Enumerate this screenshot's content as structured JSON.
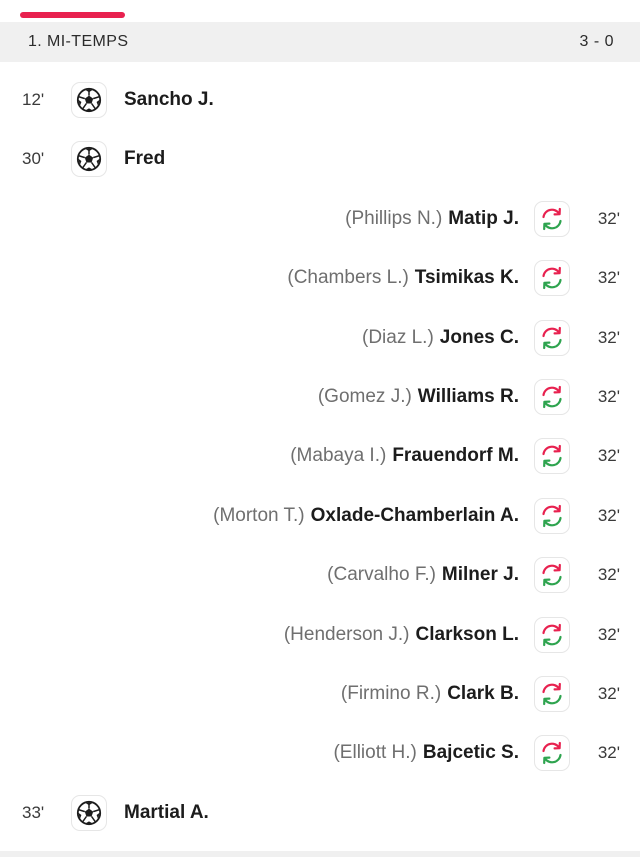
{
  "colors": {
    "accent": "#e8214f",
    "header_bg": "#f0f0f0",
    "sub_in_arrow": "#2ea44f",
    "sub_out_arrow": "#e8214f"
  },
  "period": {
    "title": "1. MI-TEMPS",
    "score": "3 - 0"
  },
  "events": [
    {
      "side": "home",
      "type": "goal",
      "minute": "12'",
      "player": "Sancho J.",
      "icon": "football-icon"
    },
    {
      "side": "home",
      "type": "goal",
      "minute": "30'",
      "player": "Fred",
      "icon": "football-icon"
    },
    {
      "side": "away",
      "type": "substitution",
      "minute": "32'",
      "player_in": "Matip J.",
      "player_out": "(Phillips N.)",
      "icon": "substitution-icon"
    },
    {
      "side": "away",
      "type": "substitution",
      "minute": "32'",
      "player_in": "Tsimikas K.",
      "player_out": "(Chambers L.)",
      "icon": "substitution-icon"
    },
    {
      "side": "away",
      "type": "substitution",
      "minute": "32'",
      "player_in": "Jones C.",
      "player_out": "(Diaz L.)",
      "icon": "substitution-icon"
    },
    {
      "side": "away",
      "type": "substitution",
      "minute": "32'",
      "player_in": "Williams R.",
      "player_out": "(Gomez J.)",
      "icon": "substitution-icon"
    },
    {
      "side": "away",
      "type": "substitution",
      "minute": "32'",
      "player_in": "Frauendorf M.",
      "player_out": "(Mabaya I.)",
      "icon": "substitution-icon"
    },
    {
      "side": "away",
      "type": "substitution",
      "minute": "32'",
      "player_in": "Oxlade-Chamberlain A.",
      "player_out": "(Morton T.)",
      "icon": "substitution-icon"
    },
    {
      "side": "away",
      "type": "substitution",
      "minute": "32'",
      "player_in": "Milner J.",
      "player_out": "(Carvalho F.)",
      "icon": "substitution-icon"
    },
    {
      "side": "away",
      "type": "substitution",
      "minute": "32'",
      "player_in": "Clarkson L.",
      "player_out": "(Henderson J.)",
      "icon": "substitution-icon"
    },
    {
      "side": "away",
      "type": "substitution",
      "minute": "32'",
      "player_in": "Clark B.",
      "player_out": "(Firmino R.)",
      "icon": "substitution-icon"
    },
    {
      "side": "away",
      "type": "substitution",
      "minute": "32'",
      "player_in": "Bajcetic S.",
      "player_out": "(Elliott H.)",
      "icon": "substitution-icon"
    },
    {
      "side": "home",
      "type": "goal",
      "minute": "33'",
      "player": "Martial A.",
      "icon": "football-icon"
    }
  ]
}
